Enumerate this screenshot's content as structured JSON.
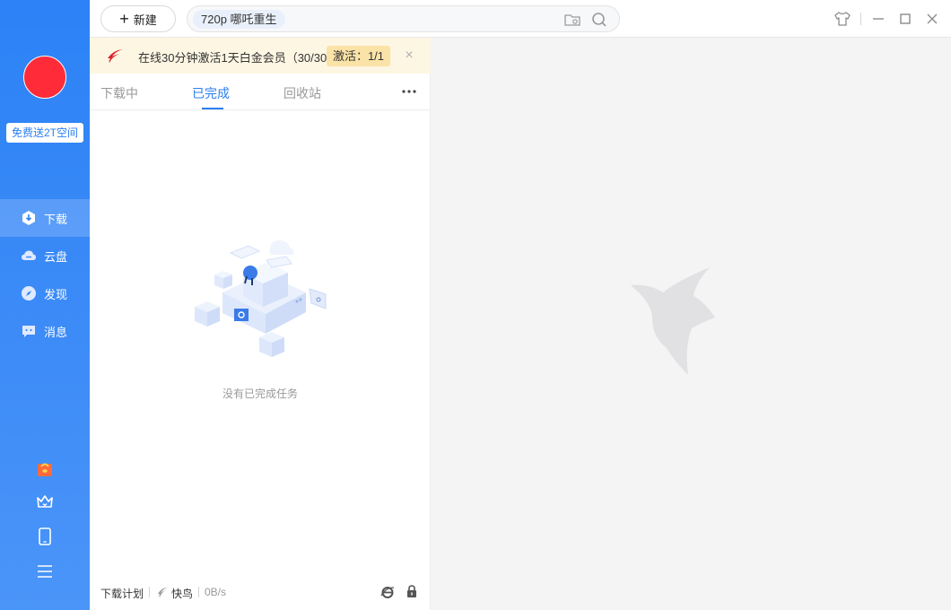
{
  "sidebar": {
    "promo_label": "免费送2T空间",
    "nav": [
      {
        "label": "下载",
        "icon": "download-icon",
        "active": true
      },
      {
        "label": "云盘",
        "icon": "cloud-icon",
        "active": false
      },
      {
        "label": "发现",
        "icon": "compass-icon",
        "active": false
      },
      {
        "label": "消息",
        "icon": "message-icon",
        "active": false
      }
    ],
    "bottom_icons": [
      "gift-icon",
      "crown-icon",
      "phone-icon",
      "menu-icon"
    ]
  },
  "toolbar": {
    "new_label": "新建",
    "search_tag": "720p  哪吒重生",
    "search_placeholder": ""
  },
  "banner": {
    "text": "在线30分钟激活1天白金会员（30/30...",
    "activate_label": "激活：1/1",
    "close_glyph": "×"
  },
  "tabs": [
    {
      "label": "下载中",
      "active": false
    },
    {
      "label": "已完成",
      "active": true
    },
    {
      "label": "回收站",
      "active": false
    }
  ],
  "empty_state": {
    "message": "没有已完成任务"
  },
  "status_bar": {
    "plan_label": "下载计划",
    "mode_label": "快鸟",
    "speed": "0B/s"
  },
  "colors": {
    "sidebar": "#2c82f6",
    "accent": "#2b7ff0",
    "avatar": "#ff2b38",
    "banner_bg": "#fdf6e3",
    "activate_bg": "#fbe3a7"
  }
}
